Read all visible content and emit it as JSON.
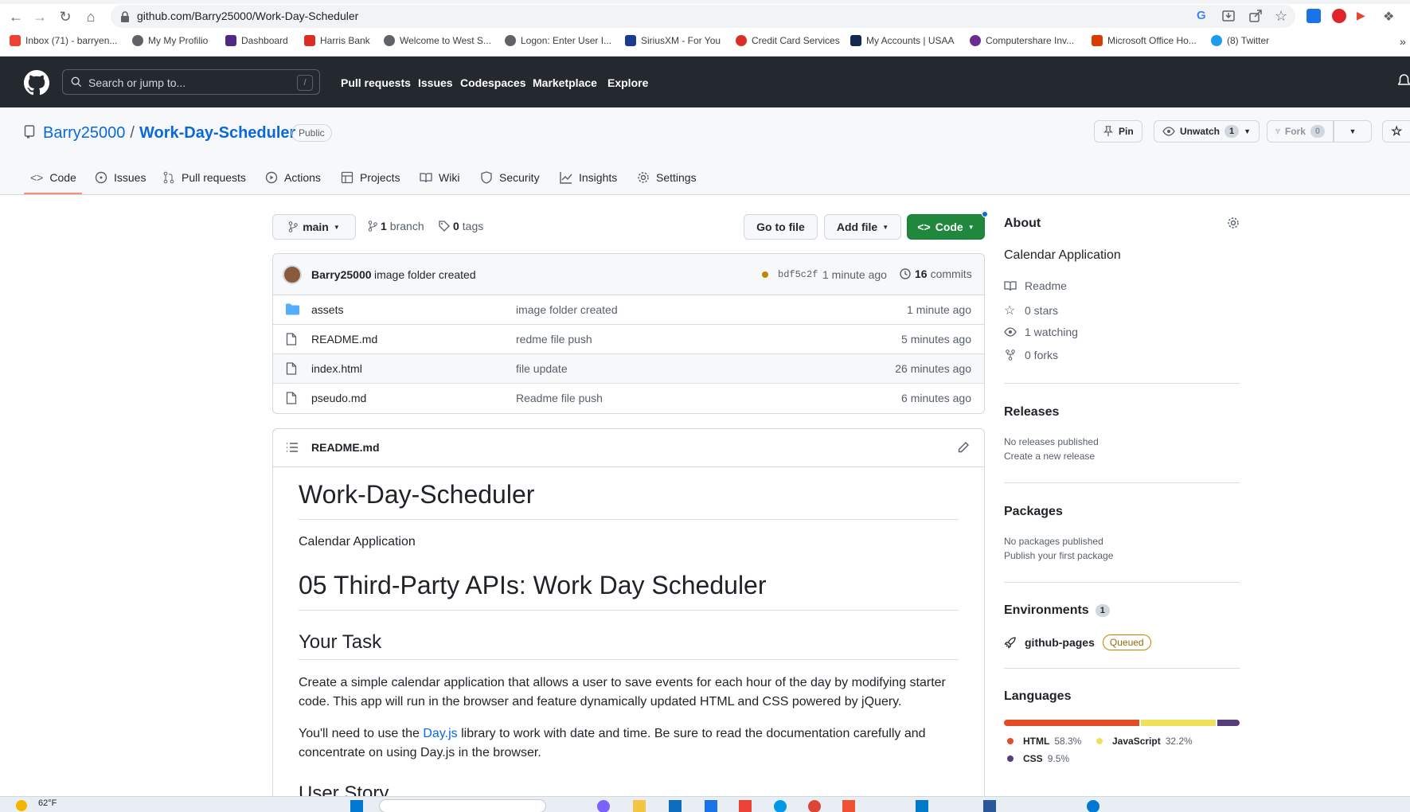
{
  "browser": {
    "url": "github.com/Barry25000/Work-Day-Scheduler",
    "bookmarks": [
      {
        "label": "Inbox (71) - barryen...",
        "color": "#ea4335"
      },
      {
        "label": "My My Profilio",
        "color": "#5f6368"
      },
      {
        "label": "Dashboard",
        "color": "#4e2a84"
      },
      {
        "label": "Harris Bank",
        "color": "#d93025"
      },
      {
        "label": "Welcome to West S...",
        "color": "#5f6368"
      },
      {
        "label": "Logon: Enter User I...",
        "color": "#5f6368"
      },
      {
        "label": "SiriusXM - For You",
        "color": "#1a3a8f"
      },
      {
        "label": "Credit Card Services",
        "color": "#d93025"
      },
      {
        "label": "My Accounts | USAA",
        "color": "#12284c"
      },
      {
        "label": "Computershare Inv...",
        "color": "#6b2c91"
      },
      {
        "label": "Microsoft Office Ho...",
        "color": "#d83b01"
      },
      {
        "label": "(8) Twitter",
        "color": "#1d9bf0"
      }
    ],
    "overflow": "»"
  },
  "gh": {
    "search_placeholder": "Search or jump to...",
    "slash": "/",
    "nav": [
      "Pull requests",
      "Issues",
      "Codespaces",
      "Marketplace",
      "Explore"
    ]
  },
  "repo": {
    "owner": "Barry25000",
    "separator": "/",
    "name": "Work-Day-Scheduler",
    "visibility": "Public",
    "pin": "Pin",
    "unwatch": "Unwatch",
    "watch_count": "1",
    "fork": "Fork",
    "fork_count": "0",
    "tabs": [
      "Code",
      "Issues",
      "Pull requests",
      "Actions",
      "Projects",
      "Wiki",
      "Security",
      "Insights",
      "Settings"
    ]
  },
  "bar": {
    "branch": "main",
    "branches_count": "1",
    "branches_label": "branch",
    "tags_count": "0",
    "tags_label": "tags",
    "go_to_file": "Go to file",
    "add_file": "Add file",
    "code": "Code"
  },
  "commit": {
    "author": "Barry25000",
    "message": "image folder created",
    "sha": "bdf5c2f",
    "time": "1 minute ago",
    "count": "16",
    "count_label": "commits"
  },
  "files": [
    {
      "name": "assets",
      "type": "folder",
      "message": "image folder created",
      "time": "1 minute ago"
    },
    {
      "name": "README.md",
      "type": "file",
      "message": "redme file push",
      "time": "5 minutes ago"
    },
    {
      "name": "index.html",
      "type": "file",
      "message": "file update",
      "time": "26 minutes ago"
    },
    {
      "name": "pseudo.md",
      "type": "file",
      "message": "Readme file push",
      "time": "6 minutes ago"
    }
  ],
  "readme": {
    "filename": "README.md",
    "h1": "Work-Day-Scheduler",
    "subtitle": "Calendar Application",
    "h1b": "05 Third-Party APIs: Work Day Scheduler",
    "h2": "Your Task",
    "p1": "Create a simple calendar application that allows a user to save events for each hour of the day by modifying starter code. This app will run in the browser and feature dynamically updated HTML and CSS powered by jQuery.",
    "p2_before": "You'll need to use the ",
    "p2_link": "Day.js",
    "p2_after": " library to work with date and time. Be sure to read the documentation carefully and concentrate on using Day.js in the browser.",
    "h2b": "User Story"
  },
  "about": {
    "title": "About",
    "description": "Calendar Application",
    "readme": "Readme",
    "stars": "0 stars",
    "watching": "1 watching",
    "forks": "0 forks"
  },
  "releases": {
    "title": "Releases",
    "none": "No releases published",
    "create": "Create a new release"
  },
  "packages": {
    "title": "Packages",
    "none": "No packages published",
    "publish": "Publish your first package"
  },
  "environments": {
    "title": "Environments",
    "count": "1",
    "name": "github-pages",
    "status": "Queued"
  },
  "languages": {
    "title": "Languages",
    "items": [
      {
        "name": "HTML",
        "percent": "58.3%",
        "value": 58.3,
        "color": "#e34c26"
      },
      {
        "name": "JavaScript",
        "percent": "32.2%",
        "value": 32.2,
        "color": "#f1e05a"
      },
      {
        "name": "CSS",
        "percent": "9.5%",
        "value": 9.5,
        "color": "#563d7c"
      }
    ]
  },
  "taskbar": {
    "weather": "62°F"
  }
}
